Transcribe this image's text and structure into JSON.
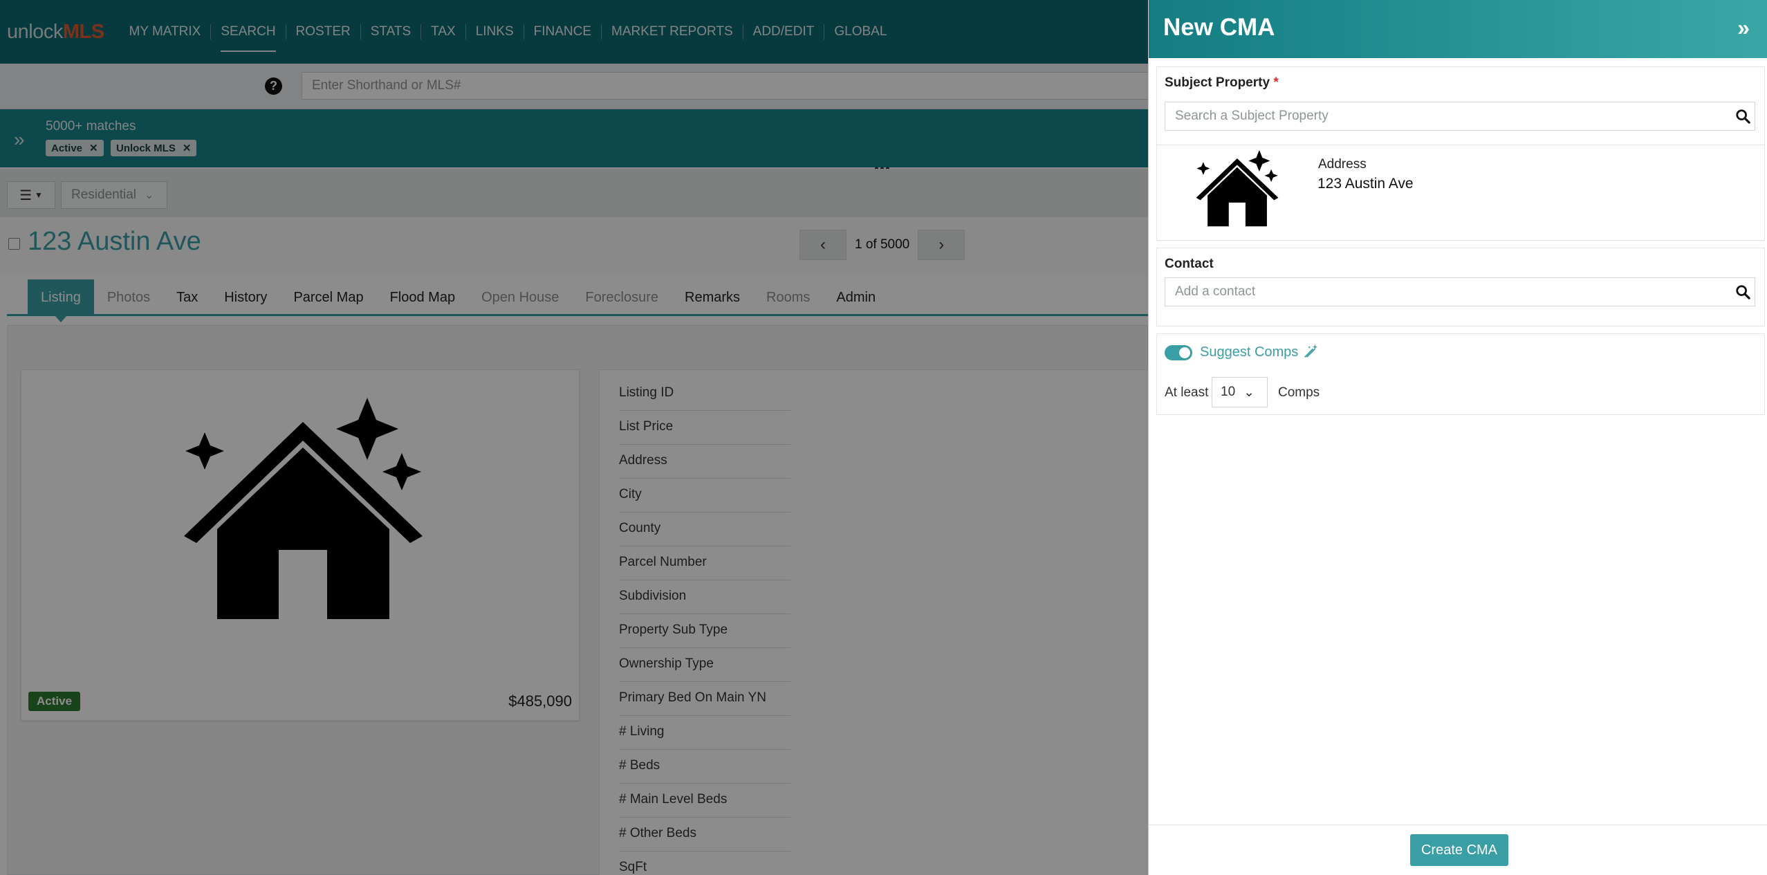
{
  "app": {
    "brand_primary": "unlock",
    "brand_accent": "MLS"
  },
  "nav": {
    "items": [
      "MY MATRIX",
      "SEARCH",
      "ROSTER",
      "STATS",
      "TAX",
      "LINKS",
      "FINANCE",
      "MARKET REPORTS",
      "ADD/EDIT",
      "GLOBAL"
    ],
    "active": "SEARCH"
  },
  "search": {
    "placeholder": "Enter Shorthand or MLS#",
    "help_icon": "question-circle-icon"
  },
  "results": {
    "count": "5000+ matches",
    "chips": [
      "Active",
      "Unlock MLS"
    ]
  },
  "toolbar": {
    "property_type": "Residential"
  },
  "listing": {
    "title": "123 Austin Ave",
    "pager": "1 of 5000",
    "status": "Active",
    "price": "$485,090"
  },
  "tabs": [
    {
      "label": "Listing",
      "state": "active"
    },
    {
      "label": "Photos",
      "state": "disabled"
    },
    {
      "label": "Tax",
      "state": "normal"
    },
    {
      "label": "History",
      "state": "normal"
    },
    {
      "label": "Parcel Map",
      "state": "normal"
    },
    {
      "label": "Flood Map",
      "state": "normal"
    },
    {
      "label": "Open House",
      "state": "disabled"
    },
    {
      "label": "Foreclosure",
      "state": "disabled"
    },
    {
      "label": "Remarks",
      "state": "normal"
    },
    {
      "label": "Rooms",
      "state": "disabled"
    },
    {
      "label": "Admin",
      "state": "normal"
    }
  ],
  "details": [
    "Listing ID",
    "List Price",
    "Address",
    "City",
    "County",
    "Parcel Number",
    "Subdivision",
    "Property Sub Type",
    "Ownership Type",
    "Primary Bed On Main YN",
    "# Living",
    "# Beds",
    "# Main Level Beds",
    "# Other Beds",
    "SqFt"
  ],
  "drawer": {
    "title": "New CMA",
    "subject_label": "Subject Property",
    "required_mark": "*",
    "subject_placeholder": "Search a Subject Property",
    "address_label": "Address",
    "address_value": "123 Austin Ave",
    "contact_label": "Contact",
    "contact_placeholder": "Add a contact",
    "suggest_label": "Suggest Comps",
    "suggest_enabled": true,
    "at_least_label": "At least",
    "comps_count": "10",
    "comps_label": "Comps",
    "create_button": "Create CMA"
  },
  "colors": {
    "nav_bg": "#0e6b73",
    "accent": "#3a9ea5",
    "brand_accent": "#e65a2c",
    "status_active": "#2e7d32",
    "required": "#d32f2f"
  }
}
